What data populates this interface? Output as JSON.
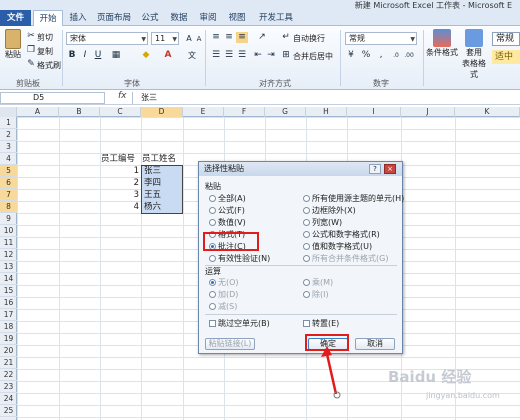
{
  "window": {
    "title": "新建 Microsoft Excel 工作表 - Microsoft E"
  },
  "tabs": [
    "文件",
    "开始",
    "插入",
    "页面布局",
    "公式",
    "数据",
    "审阅",
    "视图",
    "开发工具"
  ],
  "ribbon": {
    "paste": "粘贴",
    "cut": "剪切",
    "copy": "复制",
    "format_painter": "格式刷",
    "clipboard_group": "剪贴板",
    "font_name": "宋体",
    "font_size": "11",
    "font_group": "字体",
    "wrap_text": "自动换行",
    "merge_center": "合并后居中",
    "alignment_group": "对齐方式",
    "number_format": "常规",
    "number_group": "数字",
    "conditional_format": "条件格式",
    "table_format_line1": "套用",
    "table_format_line2": "表格格式",
    "style_normal": "常规",
    "style_medium": "适中"
  },
  "formula_bar": {
    "name_box": "D5",
    "fx": "fx",
    "content": "张三"
  },
  "columns": [
    "A",
    "B",
    "C",
    "D",
    "E",
    "F",
    "G",
    "H",
    "I",
    "J",
    "K"
  ],
  "rows": [
    "1",
    "2",
    "3",
    "4",
    "5",
    "6",
    "7",
    "8",
    "9",
    "10",
    "11",
    "12",
    "13",
    "14",
    "15",
    "16",
    "17",
    "18",
    "19",
    "20",
    "21",
    "22",
    "23",
    "24",
    "25"
  ],
  "sheet": {
    "header_c": "员工编号",
    "header_d": "员工姓名",
    "ids": [
      "1",
      "2",
      "3",
      "4"
    ],
    "names": [
      "张三",
      "李四",
      "王五",
      "杨六"
    ]
  },
  "dialog": {
    "title": "选择性粘贴",
    "help": "?",
    "close": "×",
    "paste_section": "粘贴",
    "paste_left": [
      "全部(A)",
      "公式(F)",
      "数值(V)",
      "格式(T)",
      "批注(C)",
      "有效性验证(N)"
    ],
    "paste_right": [
      "所有使用源主题的单元(H)",
      "边框除外(X)",
      "列宽(W)",
      "公式和数字格式(R)",
      "值和数字格式(U)",
      "所有合并条件格式(G)"
    ],
    "paste_selected": "批注(C)",
    "operation_section": "运算",
    "op_left": [
      "无(O)",
      "加(D)",
      "减(S)"
    ],
    "op_right": [
      "乘(M)",
      "除(I)"
    ],
    "skip_blanks": "跳过空单元(B)",
    "transpose": "转置(E)",
    "paste_link": "粘贴链接(L)",
    "ok": "确定",
    "cancel": "取消"
  },
  "watermark": {
    "brand": "Baidu 经验",
    "sub": "jingyan.baidu.com"
  },
  "colors": {
    "accent": "#2a5ea8",
    "highlight": "#e21b1b",
    "selection": "#c9dbf2"
  }
}
